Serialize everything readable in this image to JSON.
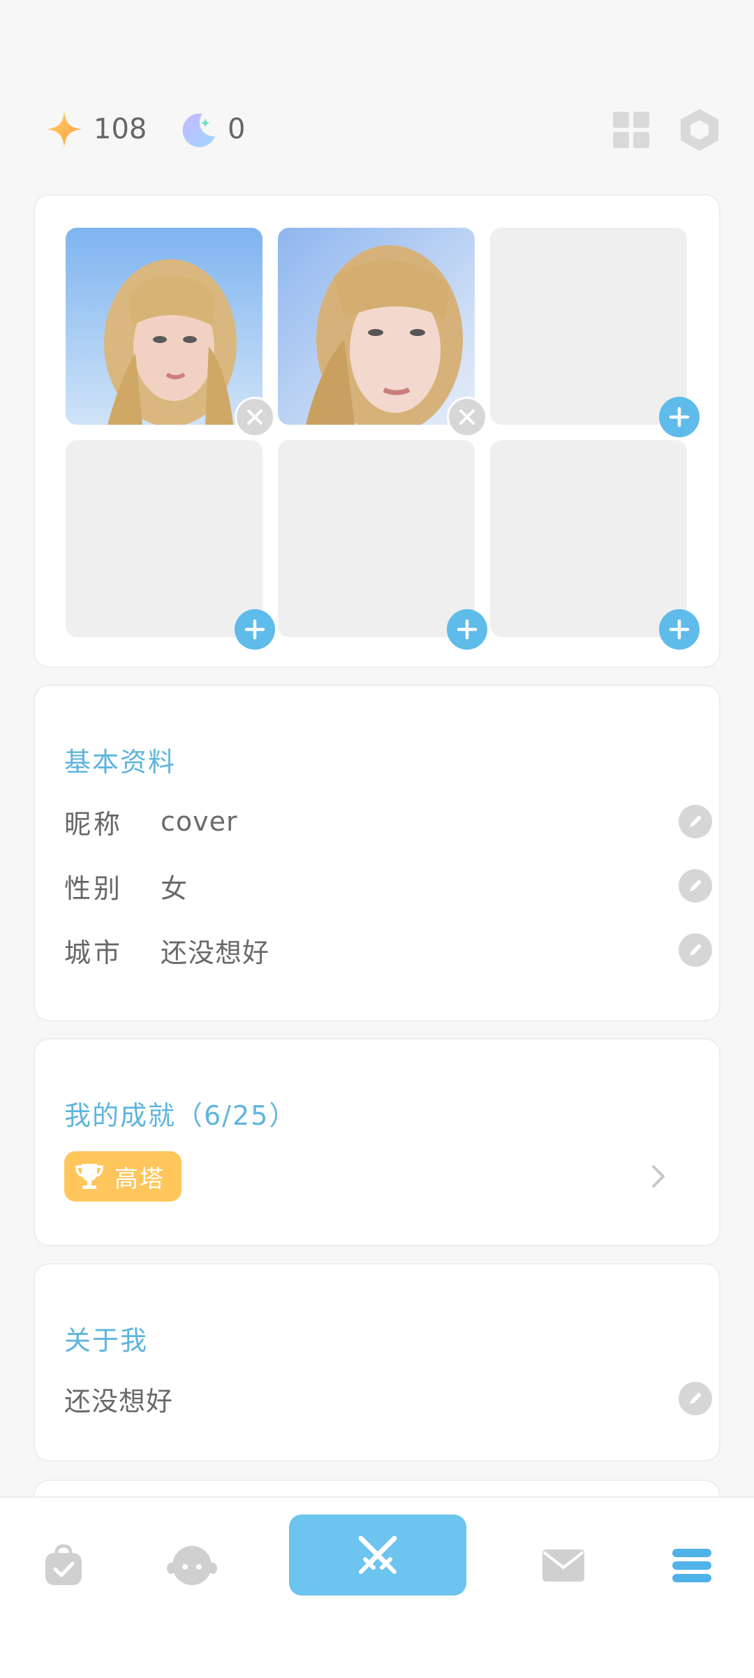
{
  "header": {
    "stars_count": "108",
    "moons_count": "0",
    "icons": [
      "star-icon",
      "moon-icon",
      "grid-icon",
      "hexagon-settings-icon"
    ]
  },
  "photos": {
    "slots": [
      {
        "filled": true,
        "action": "remove"
      },
      {
        "filled": true,
        "action": "remove"
      },
      {
        "filled": false,
        "action": "add"
      },
      {
        "filled": false,
        "action": "add"
      },
      {
        "filled": false,
        "action": "add"
      },
      {
        "filled": false,
        "action": "add"
      }
    ]
  },
  "basic_info": {
    "title": "基本资料",
    "rows": [
      {
        "label": "昵称",
        "value": "cover"
      },
      {
        "label": "性别",
        "value": "女"
      },
      {
        "label": "城市",
        "value": "还没想好"
      }
    ]
  },
  "achievements": {
    "title": "我的成就（6/25）",
    "badge_label": "高塔"
  },
  "about": {
    "title": "关于我",
    "text": "还没想好"
  },
  "nav": {
    "items": [
      "bag-check-icon",
      "face-icon",
      "crossed-swords-icon",
      "mail-icon",
      "menu-icon"
    ],
    "active": "crossed-swords-icon"
  },
  "colors": {
    "accent": "#5ebbea",
    "nav_active": "#6cc4ef",
    "achievement_badge": "#ffc65c",
    "section_title": "#5fb5dd"
  }
}
